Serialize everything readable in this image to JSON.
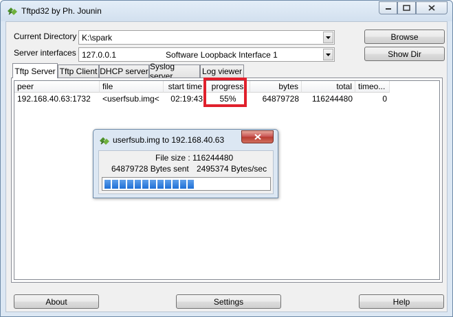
{
  "window": {
    "title": "Tftpd32 by Ph. Jounin"
  },
  "form": {
    "current_directory_label": "Current Directory",
    "current_directory_value": "K:\\spark",
    "server_interfaces_label": "Server interfaces",
    "server_interface_ip": "127.0.0.1",
    "server_interface_name": "Software Loopback Interface 1",
    "browse_label": "Browse",
    "show_dir_label": "Show Dir"
  },
  "tabs": [
    {
      "label": "Tftp Server"
    },
    {
      "label": "Tftp Client"
    },
    {
      "label": "DHCP server"
    },
    {
      "label": "Syslog server"
    },
    {
      "label": "Log viewer"
    }
  ],
  "table": {
    "headers": [
      "peer",
      "file",
      "start time",
      "progress",
      "bytes",
      "total",
      "timeo..."
    ],
    "rows": [
      {
        "peer": "192.168.40.63:1732",
        "file": "<userfsub.img<",
        "start_time": "02:19:43",
        "progress": "55%",
        "bytes": "64879728",
        "total": "116244480",
        "timeout": "0"
      }
    ]
  },
  "dialog": {
    "title": "userfsub.img to 192.168.40.63",
    "file_size": "File size : 116244480",
    "bytes_sent": "64879728 Bytes sent",
    "rate": "2495374 Bytes/sec",
    "progress_fraction": 0.56
  },
  "footer": {
    "about_label": "About",
    "settings_label": "Settings",
    "help_label": "Help"
  },
  "colors": {
    "highlight": "#e0202c",
    "progress": "#1f6fd6"
  },
  "icons": {
    "app": "tftpd-icon",
    "minimize": "minimize-icon",
    "maximize": "maximize-icon",
    "close": "close-icon"
  }
}
